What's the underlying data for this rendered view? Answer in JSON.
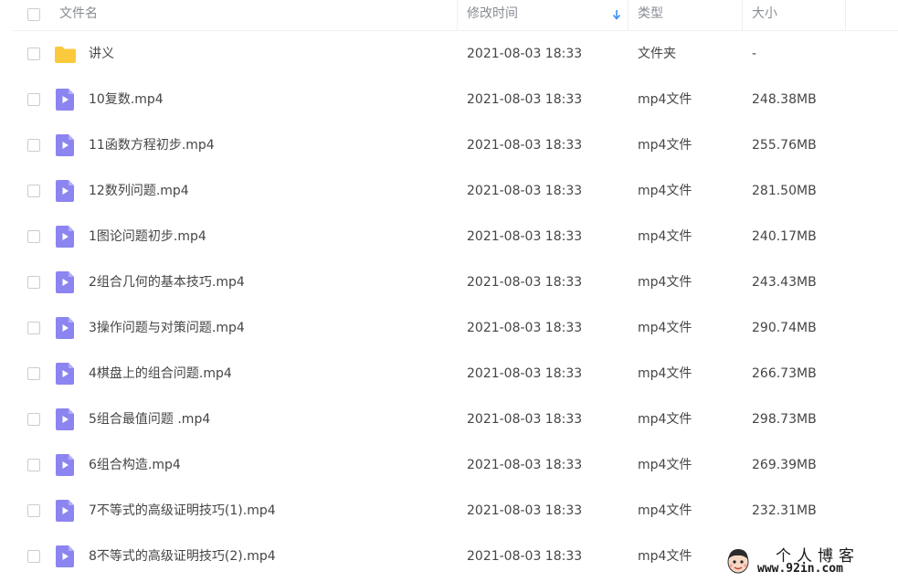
{
  "header": {
    "name_label": "文件名",
    "time_label": "修改时间",
    "type_label": "类型",
    "size_label": "大小"
  },
  "colors": {
    "folder": "#fbc93c",
    "video": "#8c84f0",
    "sort_arrow": "#3b8ff5"
  },
  "rows": [
    {
      "name": "讲义",
      "time": "2021-08-03 18:33",
      "type": "文件夹",
      "size": "-",
      "icon": "folder-icon"
    },
    {
      "name": "10复数.mp4",
      "time": "2021-08-03 18:33",
      "type": "mp4文件",
      "size": "248.38MB",
      "icon": "video-file-icon"
    },
    {
      "name": "11函数方程初步.mp4",
      "time": "2021-08-03 18:33",
      "type": "mp4文件",
      "size": "255.76MB",
      "icon": "video-file-icon"
    },
    {
      "name": "12数列问题.mp4",
      "time": "2021-08-03 18:33",
      "type": "mp4文件",
      "size": "281.50MB",
      "icon": "video-file-icon"
    },
    {
      "name": "1图论问题初步.mp4",
      "time": "2021-08-03 18:33",
      "type": "mp4文件",
      "size": "240.17MB",
      "icon": "video-file-icon"
    },
    {
      "name": "2组合几何的基本技巧.mp4",
      "time": "2021-08-03 18:33",
      "type": "mp4文件",
      "size": "243.43MB",
      "icon": "video-file-icon"
    },
    {
      "name": "3操作问题与对策问题.mp4",
      "time": "2021-08-03 18:33",
      "type": "mp4文件",
      "size": "290.74MB",
      "icon": "video-file-icon"
    },
    {
      "name": "4棋盘上的组合问题.mp4",
      "time": "2021-08-03 18:33",
      "type": "mp4文件",
      "size": "266.73MB",
      "icon": "video-file-icon"
    },
    {
      "name": "5组合最值问题 .mp4",
      "time": "2021-08-03 18:33",
      "type": "mp4文件",
      "size": "298.73MB",
      "icon": "video-file-icon"
    },
    {
      "name": "6组合构造.mp4",
      "time": "2021-08-03 18:33",
      "type": "mp4文件",
      "size": "269.39MB",
      "icon": "video-file-icon"
    },
    {
      "name": "7不等式的高级证明技巧(1).mp4",
      "time": "2021-08-03 18:33",
      "type": "mp4文件",
      "size": "232.31MB",
      "icon": "video-file-icon"
    },
    {
      "name": "8不等式的高级证明技巧(2).mp4",
      "time": "2021-08-03 18:33",
      "type": "mp4文件",
      "size": "",
      "icon": "video-file-icon"
    }
  ],
  "watermark": {
    "title": "个人博客",
    "url": "www.92in.com"
  }
}
